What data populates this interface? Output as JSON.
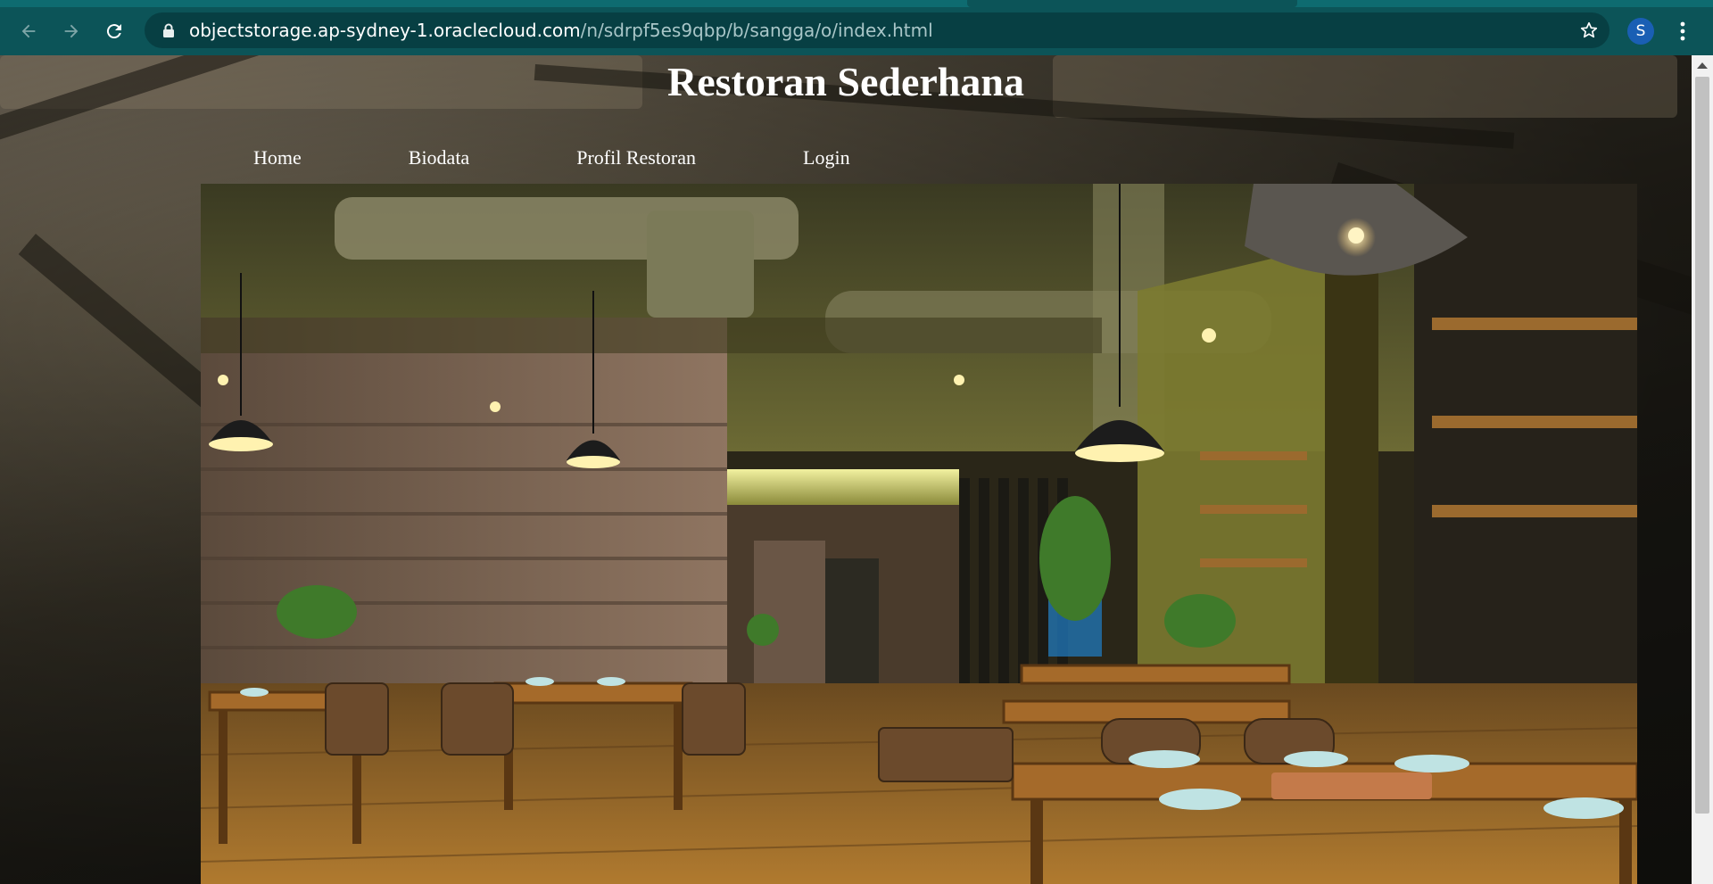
{
  "browser": {
    "url_host": "objectstorage.ap-sydney-1.oraclecloud.com",
    "url_path": "/n/sdrpf5es9qbp/b/sangga/o/index.html",
    "profile_initial": "S"
  },
  "page": {
    "title": "Restoran Sederhana",
    "nav": {
      "home": "Home",
      "biodata": "Biodata",
      "profil": "Profil Restoran",
      "login": "Login"
    }
  },
  "icons": [
    "back-arrow-icon",
    "forward-arrow-icon",
    "reload-icon",
    "lock-icon",
    "star-icon",
    "kebab-menu-icon"
  ],
  "colors": {
    "toolbar": "#0c5458",
    "tabstrip": "#0e6b70",
    "omnibox": "#073f43",
    "profile": "#1a5fb4"
  }
}
